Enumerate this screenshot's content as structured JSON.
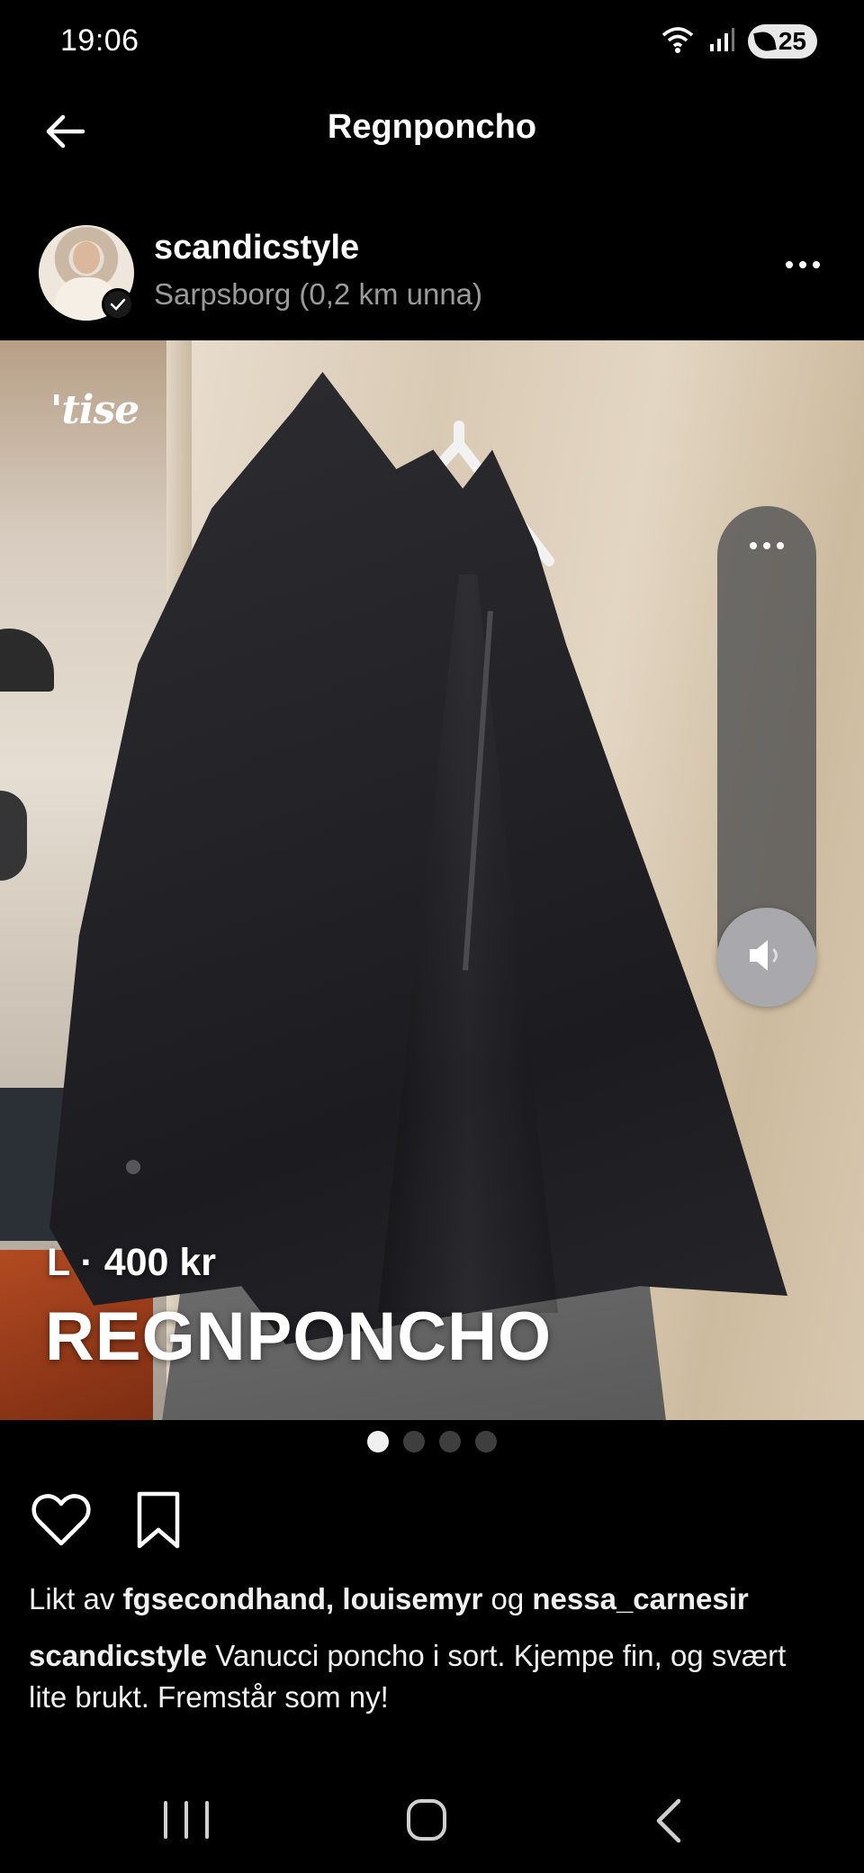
{
  "status_bar": {
    "time": "19:06",
    "battery": "25",
    "icons": [
      "wifi-icon",
      "signal-icon",
      "battery-saver-icon"
    ]
  },
  "app_bar": {
    "title": "Regnponcho",
    "back_icon": "arrow-left-icon"
  },
  "seller": {
    "username": "scandicstyle",
    "location": "Sarpsborg (0,2 km unna)",
    "verified": true,
    "menu_icon": "more-horizontal-icon"
  },
  "listing": {
    "watermark": "'tise",
    "size_price": "L · 400 kr",
    "title": "REGNPONCHO",
    "image_count": 4,
    "active_image": 1
  },
  "actions": {
    "like_icon": "heart-icon",
    "save_icon": "bookmark-icon"
  },
  "likes": {
    "prefix": "Likt av",
    "user1": "fgsecondhand,",
    "user2": "louisemyr",
    "joiner": "og",
    "user3": "nessa_carnesir"
  },
  "caption": {
    "username": "scandicstyle",
    "text": "Vanucci poncho i sort. Kjempe fin, og svært lite brukt. Fremstår som ny!"
  },
  "colors": {
    "background": "#000000",
    "secondary_text": "#9a9a9a",
    "dot_active": "#f0f0f0",
    "dot_inactive": "#3e3e3e"
  }
}
